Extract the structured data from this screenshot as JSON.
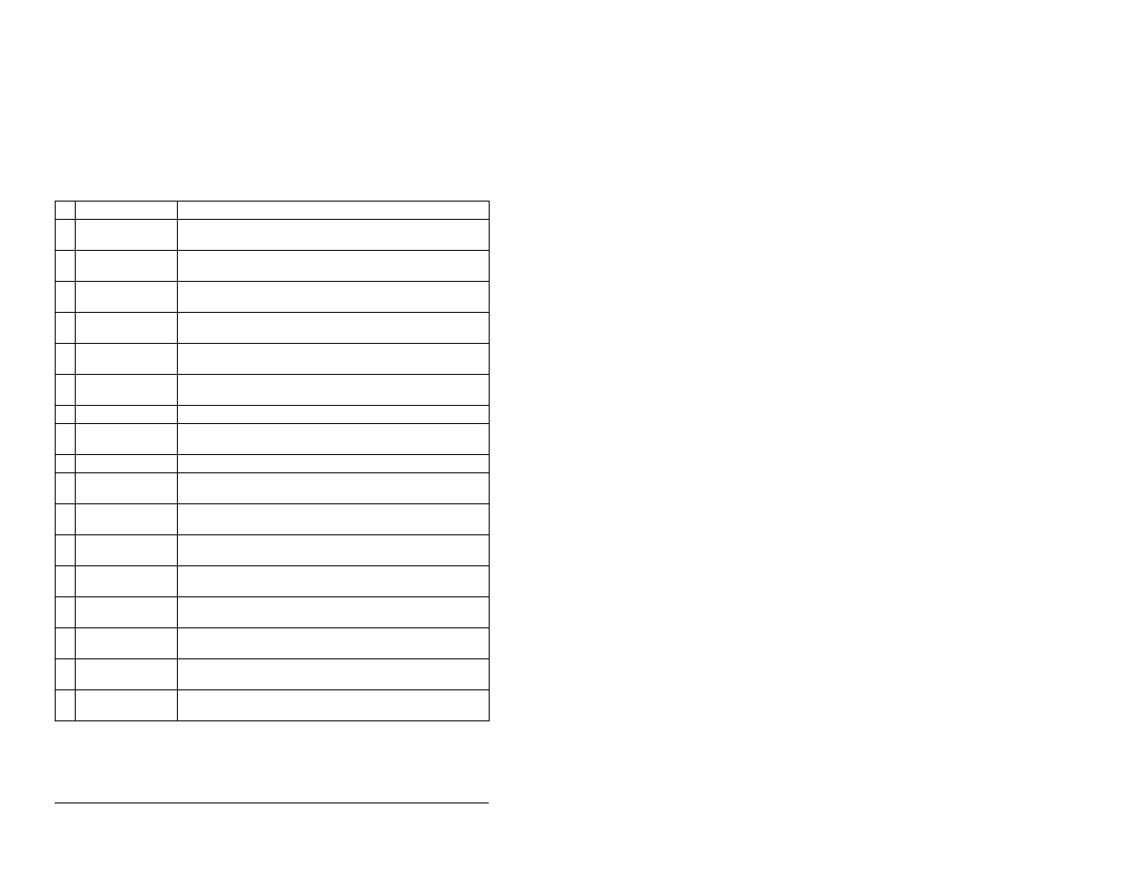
{
  "table": {
    "columns": [
      "",
      "",
      ""
    ],
    "rows": [
      {
        "c0": "",
        "c1": "",
        "c2": ""
      },
      {
        "c0": "",
        "c1": "",
        "c2": ""
      },
      {
        "c0": "",
        "c1": "",
        "c2": ""
      },
      {
        "c0": "",
        "c1": "",
        "c2": ""
      },
      {
        "c0": "",
        "c1": "",
        "c2": ""
      },
      {
        "c0": "",
        "c1": "",
        "c2": ""
      },
      {
        "c0": "",
        "c1": "",
        "c2": ""
      },
      {
        "c0": "",
        "c1": "",
        "c2": ""
      },
      {
        "c0": "",
        "c1": "",
        "c2": ""
      },
      {
        "c0": "",
        "c1": "",
        "c2": ""
      },
      {
        "c0": "",
        "c1": "",
        "c2": ""
      },
      {
        "c0": "",
        "c1": "",
        "c2": ""
      },
      {
        "c0": "",
        "c1": "",
        "c2": ""
      },
      {
        "c0": "",
        "c1": "",
        "c2": ""
      },
      {
        "c0": "",
        "c1": "",
        "c2": ""
      },
      {
        "c0": "",
        "c1": "",
        "c2": ""
      },
      {
        "c0": "",
        "c1": "",
        "c2": ""
      },
      {
        "c0": "",
        "c1": "",
        "c2": ""
      }
    ]
  },
  "separator": true
}
